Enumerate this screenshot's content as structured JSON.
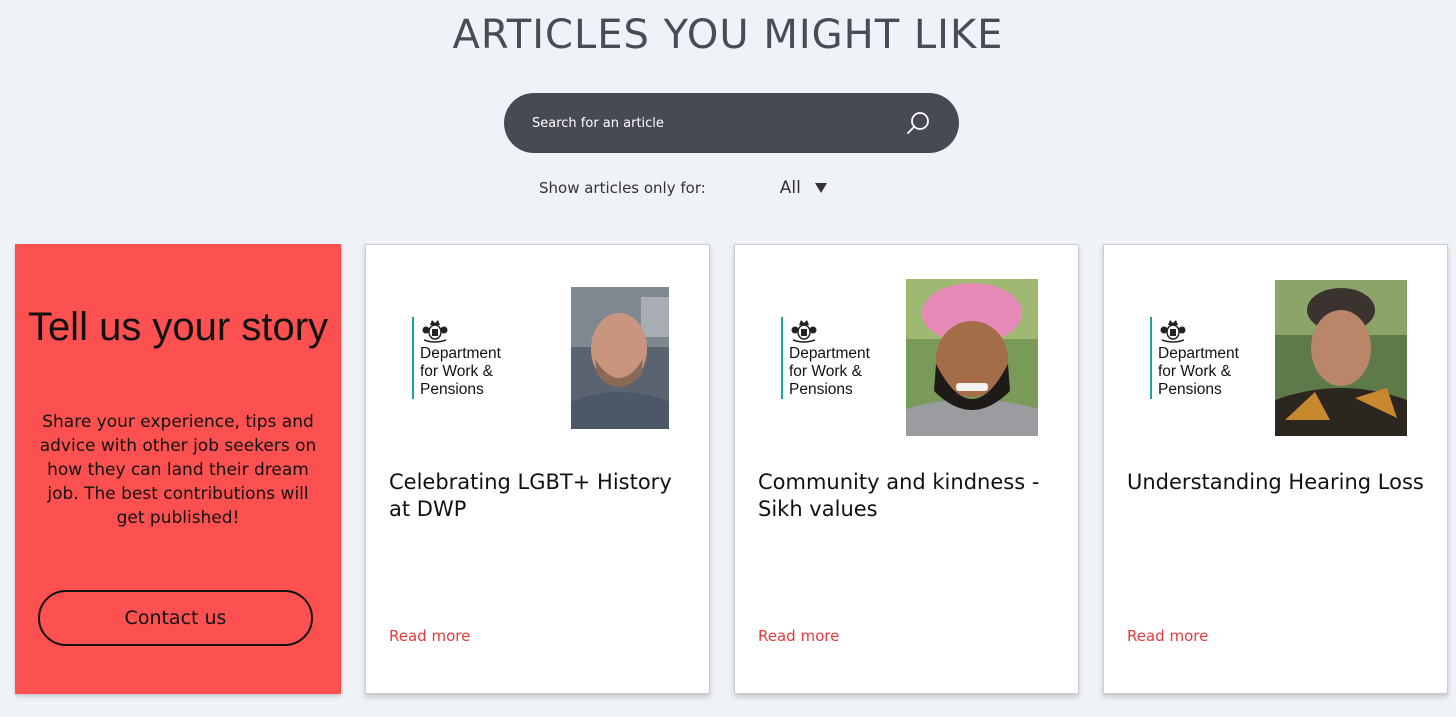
{
  "page_title": "ARTICLES YOU MIGHT LIKE",
  "search": {
    "placeholder": "Search for an article",
    "icon": "search-icon"
  },
  "filter": {
    "label": "Show articles only for:",
    "selected": "All"
  },
  "story_card": {
    "title": "Tell us your story",
    "text": "Share your experience, tips and advice with other job seekers on how they can land their dream job. The best contributions will get published!",
    "button_label": "Contact us",
    "background": "#fc5150"
  },
  "articles": [
    {
      "logo_lines": [
        "Department",
        "for Work &",
        "Pensions"
      ],
      "title": "Celebrating LGBT+ History at DWP",
      "link_label": "Read more"
    },
    {
      "logo_lines": [
        "Department",
        "for Work &",
        "Pensions"
      ],
      "title": "Community and kindness - Sikh values",
      "link_label": "Read more"
    },
    {
      "logo_lines": [
        "Department",
        "for Work &",
        "Pensions"
      ],
      "title": "Understanding Hearing Loss",
      "link_label": "Read more"
    }
  ],
  "colors": {
    "page_background": "#eff2f7",
    "search_bar": "#474a54",
    "accent_red": "#fc5150",
    "link_red": "#e43b3b",
    "dwp_teal": "#19a59a"
  }
}
